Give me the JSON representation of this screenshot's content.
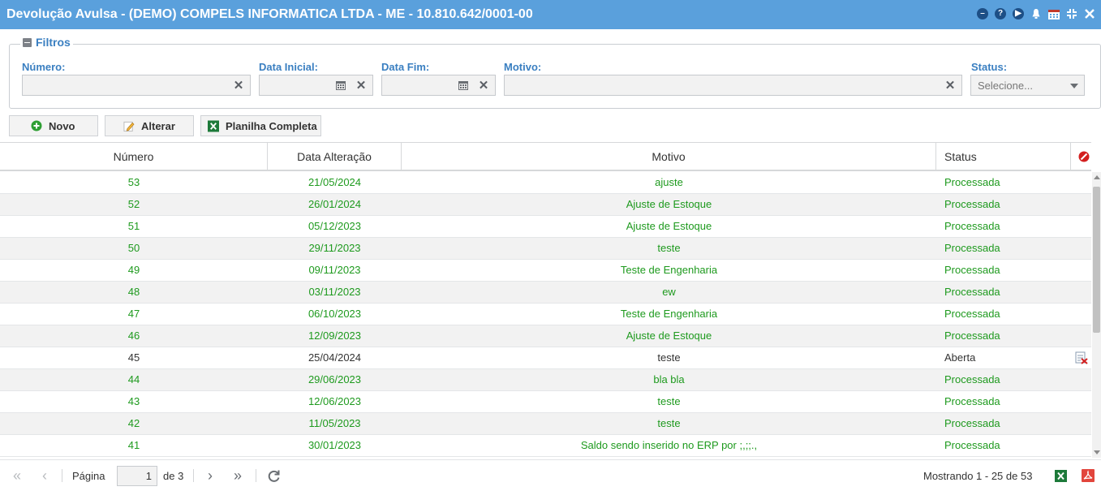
{
  "window": {
    "title": "Devolução Avulsa - (DEMO) COMPELS INFORMATICA LTDA - ME - 10.810.642/0001-00",
    "icons": [
      "minimize-icon",
      "help-icon",
      "play-icon",
      "bell-icon",
      "calendar-icon",
      "collapse-icon",
      "close-icon"
    ]
  },
  "filters": {
    "legend": "Filtros",
    "numero_label": "Número:",
    "numero_value": "",
    "data_inicial_label": "Data Inicial:",
    "data_inicial_value": "",
    "data_fim_label": "Data Fim:",
    "data_fim_value": "",
    "motivo_label": "Motivo:",
    "motivo_value": "",
    "status_label": "Status:",
    "status_value": "Selecione..."
  },
  "toolbar": {
    "novo": "Novo",
    "alterar": "Alterar",
    "planilha": "Planilha Completa"
  },
  "grid": {
    "columns": {
      "numero": "Número",
      "data": "Data Alteração",
      "motivo": "Motivo",
      "status": "Status"
    },
    "rows": [
      {
        "numero": "53",
        "data": "21/05/2024",
        "motivo": "ajuste",
        "status": "Processada"
      },
      {
        "numero": "52",
        "data": "26/01/2024",
        "motivo": "Ajuste de Estoque",
        "status": "Processada"
      },
      {
        "numero": "51",
        "data": "05/12/2023",
        "motivo": "Ajuste de Estoque",
        "status": "Processada"
      },
      {
        "numero": "50",
        "data": "29/11/2023",
        "motivo": "teste",
        "status": "Processada"
      },
      {
        "numero": "49",
        "data": "09/11/2023",
        "motivo": "Teste de Engenharia",
        "status": "Processada"
      },
      {
        "numero": "48",
        "data": "03/11/2023",
        "motivo": "ew",
        "status": "Processada"
      },
      {
        "numero": "47",
        "data": "06/10/2023",
        "motivo": "Teste de Engenharia",
        "status": "Processada"
      },
      {
        "numero": "46",
        "data": "12/09/2023",
        "motivo": "Ajuste de Estoque",
        "status": "Processada"
      },
      {
        "numero": "45",
        "data": "25/04/2024",
        "motivo": "teste",
        "status": "Aberta"
      },
      {
        "numero": "44",
        "data": "29/06/2023",
        "motivo": "bla bla",
        "status": "Processada"
      },
      {
        "numero": "43",
        "data": "12/06/2023",
        "motivo": "teste",
        "status": "Processada"
      },
      {
        "numero": "42",
        "data": "11/05/2023",
        "motivo": "teste",
        "status": "Processada"
      },
      {
        "numero": "41",
        "data": "30/01/2023",
        "motivo": "Saldo sendo inserido no ERP por ;,;;.,",
        "status": "Processada"
      }
    ]
  },
  "pager": {
    "page_label": "Página",
    "page_value": "1",
    "of_label": "de 3",
    "showing": "Mostrando 1 - 25 de 53"
  },
  "colors": {
    "titlebar": "#5aa0dc",
    "label_blue": "#3a7fc1",
    "processed_green": "#1e9a1e",
    "excel_green": "#1d7a3a",
    "pdf_red": "#e2453c"
  }
}
